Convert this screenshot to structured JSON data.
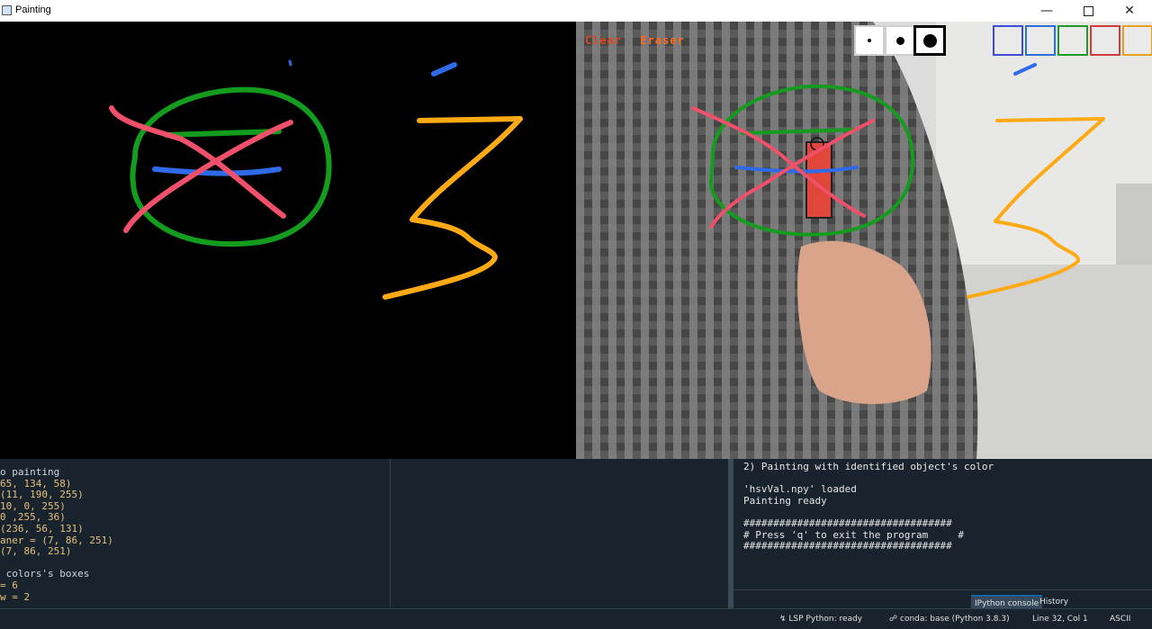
{
  "window": {
    "title": "Painting",
    "minimize_icon": "minimize-icon",
    "maximize_icon": "maximize-icon",
    "close_icon": "close-icon"
  },
  "camera_view": {
    "clear_label": "Clear",
    "eraser_label": "Eraser",
    "brush_sizes": [
      "small",
      "medium",
      "large"
    ],
    "selected_brush": "large",
    "palette_colors": [
      "#3a4cd8",
      "#2a70d8",
      "#1d9a28",
      "#d03a40",
      "#e8a020"
    ]
  },
  "stroke_colors": {
    "green": "#139c1d",
    "red": "#f0506a",
    "blue": "#2f6ae8",
    "orange": "#ffaa14"
  },
  "editor": {
    "lines": [
      "o painting",
      "65, 134, 58)",
      "(11, 190, 255)",
      "10, 0, 255)",
      "0 ,255, 36)",
      "(236, 56, 131)",
      "aner = (7, 86, 251)",
      "(7, 86, 251)",
      "",
      " colors's boxes",
      "= 6",
      "w = 2"
    ]
  },
  "console": {
    "lines": [
      "2) Painting with identified object's color",
      "",
      "'hsvVal.npy' loaded",
      "Painting ready",
      "",
      "###################################",
      "# Press 'q' to exit the program     #",
      "###################################"
    ],
    "tabs": [
      "IPython console",
      "History"
    ]
  },
  "status_bar": {
    "lsp": "LSP Python: ready",
    "conda": "conda: base (Python 3.8.3)",
    "position": "Line 32, Col 1",
    "encoding": "ASCII"
  }
}
